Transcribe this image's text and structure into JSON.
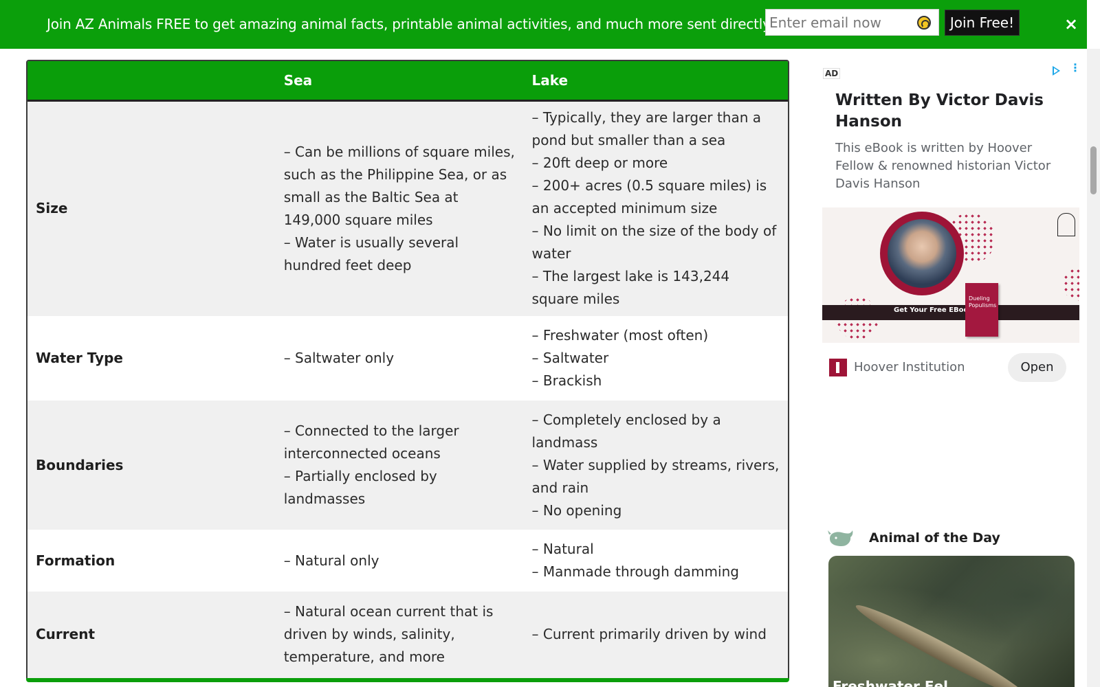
{
  "banner": {
    "text": "Join AZ Animals FREE to get amazing animal facts, printable animal activities, and much more sent directly to you",
    "email_placeholder": "Enter email now",
    "join_label": "Join Free!",
    "close_label": "×",
    "background_color": "#0b9f0b"
  },
  "table": {
    "headers": [
      "",
      "Sea",
      "Lake"
    ],
    "header_color": "#0a9e0a",
    "rows": [
      {
        "label": "Size",
        "sea": [
          "– Can be millions of square miles, such as the Philippine Sea, or as small as the Baltic Sea at 149,000 square miles",
          "– Water is usually several hundred feet deep"
        ],
        "lake": [
          "– Typically, they are larger than a pond but smaller than a sea",
          "– 20ft deep or more",
          "– 200+ acres (0.5 square miles) is an accepted minimum size",
          "– No limit on the size of the body of water",
          "– The largest lake is 143,244 square miles"
        ]
      },
      {
        "label": "Water Type",
        "sea": [
          "– Saltwater only"
        ],
        "lake": [
          "– Freshwater (most often)",
          "– Saltwater",
          "– Brackish"
        ]
      },
      {
        "label": "Boundaries",
        "sea": [
          "– Connected to the larger interconnected oceans",
          "– Partially enclosed by landmasses"
        ],
        "lake": [
          "– Completely enclosed by a landmass",
          "– Water supplied by streams, rivers, and rain",
          "– No opening"
        ]
      },
      {
        "label": "Formation",
        "sea": [
          "– Natural only"
        ],
        "lake": [
          "– Natural",
          "– Manmade through damming"
        ]
      },
      {
        "label": "Current",
        "sea": [
          "– Natural ocean current that is driven by winds, salinity, temperature, and more"
        ],
        "lake": [
          "– Current primarily driven by wind"
        ]
      }
    ]
  },
  "ad": {
    "badge": "AD",
    "title": "Written By Victor Davis Hanson",
    "description": "This eBook is written by Hoover Fellow & renowned historian Victor Davis Hanson",
    "image_strip_text": "Get Your Free EBook",
    "book_text": "Dueling Populisms",
    "advertiser": "Hoover Institution",
    "open_label": "Open",
    "accent_color": "#9e1437"
  },
  "animal_of_the_day": {
    "title": "Animal of the Day",
    "caption": "Freshwater Eel",
    "icon": "whale-icon"
  }
}
